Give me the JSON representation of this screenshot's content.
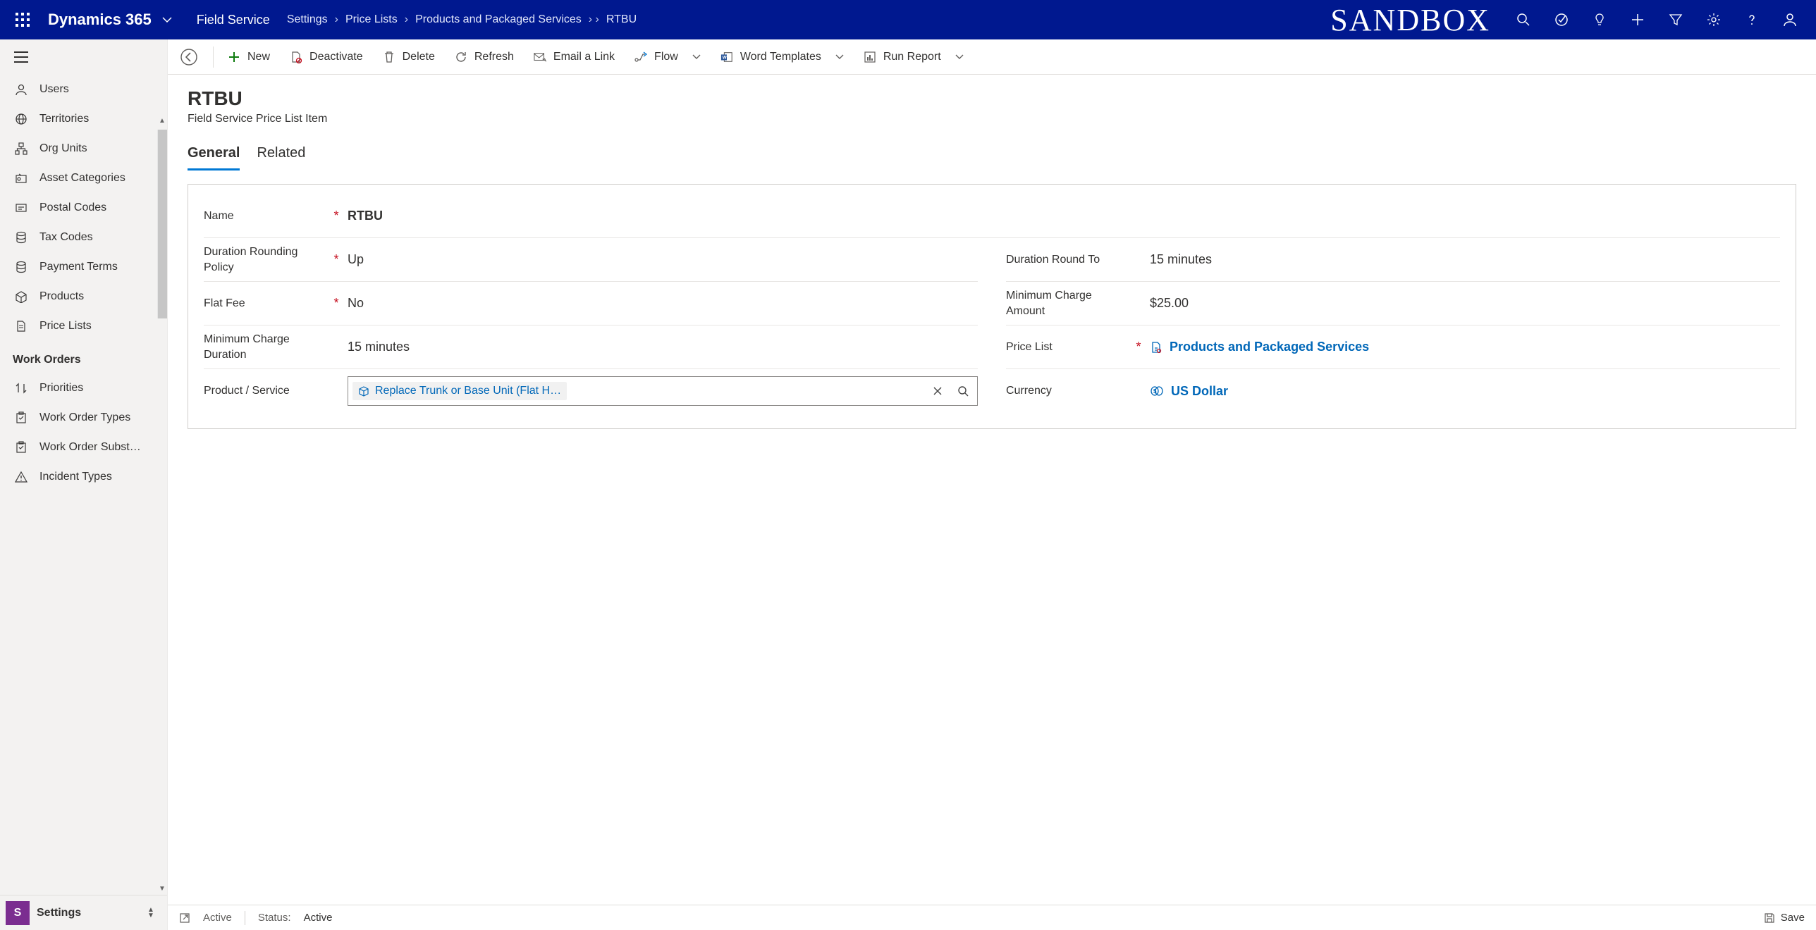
{
  "top": {
    "brand": "Dynamics 365",
    "app": "Field Service",
    "breadcrumbs": [
      "Settings",
      "Price Lists",
      "Products and Packaged Services",
      "RTBU"
    ],
    "sandbox": "SANDBOX"
  },
  "sidebar": {
    "items1": [
      {
        "label": "Users",
        "icon": "user"
      },
      {
        "label": "Territories",
        "icon": "globe"
      },
      {
        "label": "Org Units",
        "icon": "org"
      },
      {
        "label": "Asset Categories",
        "icon": "asset"
      },
      {
        "label": "Postal Codes",
        "icon": "postal"
      },
      {
        "label": "Tax Codes",
        "icon": "db"
      },
      {
        "label": "Payment Terms",
        "icon": "db"
      },
      {
        "label": "Products",
        "icon": "box"
      },
      {
        "label": "Price Lists",
        "icon": "doc"
      }
    ],
    "group2": "Work Orders",
    "items2": [
      {
        "label": "Priorities",
        "icon": "sort"
      },
      {
        "label": "Work Order Types",
        "icon": "clip"
      },
      {
        "label": "Work Order Subst…",
        "icon": "clip"
      },
      {
        "label": "Incident Types",
        "icon": "warn"
      }
    ],
    "area_initial": "S",
    "area": "Settings"
  },
  "commands": {
    "new": "New",
    "deactivate": "Deactivate",
    "delete": "Delete",
    "refresh": "Refresh",
    "email": "Email a Link",
    "flow": "Flow",
    "word": "Word Templates",
    "report": "Run Report"
  },
  "page": {
    "title": "RTBU",
    "subtitle": "Field Service Price List Item",
    "tabs": {
      "general": "General",
      "related": "Related"
    }
  },
  "form": {
    "name_label": "Name",
    "name_value": "RTBU",
    "drp_label": "Duration Rounding Policy",
    "drp_value": "Up",
    "drt_label": "Duration Round To",
    "drt_value": "15 minutes",
    "flat_label": "Flat Fee",
    "flat_value": "No",
    "mca_label": "Minimum Charge Amount",
    "mca_value": "$25.00",
    "mcd_label": "Minimum Charge Duration",
    "mcd_value": "15 minutes",
    "pl_label": "Price List",
    "pl_value": "Products and Packaged Services",
    "ps_label": "Product / Service",
    "ps_value": "Replace Trunk or Base Unit (Flat H…",
    "cur_label": "Currency",
    "cur_value": "US Dollar"
  },
  "status": {
    "state": "Active",
    "status_label": "Status:",
    "status_value": "Active",
    "save": "Save"
  }
}
